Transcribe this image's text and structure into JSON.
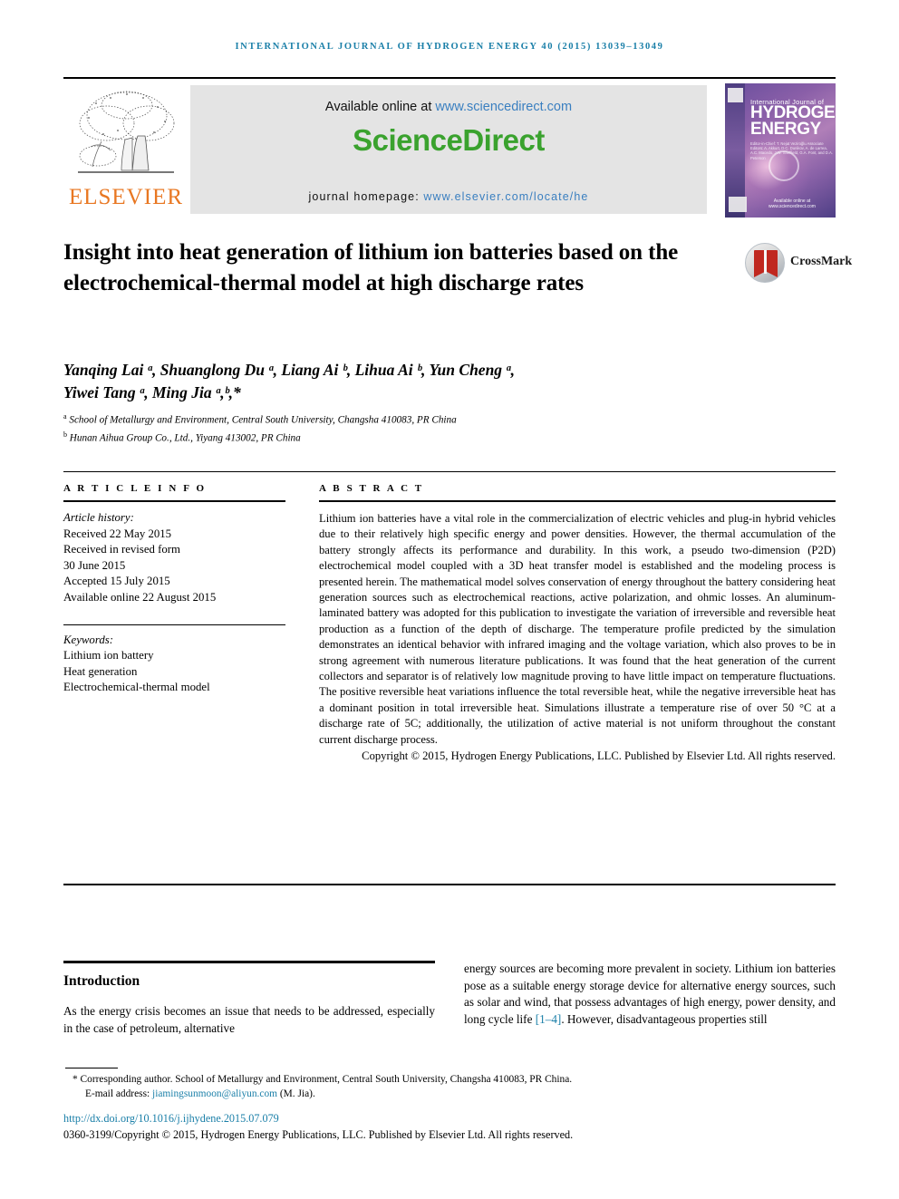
{
  "running_head": "INTERNATIONAL JOURNAL OF HYDROGEN ENERGY 40 (2015) 13039–13049",
  "masthead": {
    "publisher_name": "ELSEVIER",
    "publisher_logo_icon": "elsevier-tree-icon",
    "available_online_label": "Available online at ",
    "available_online_url": "www.sciencedirect.com",
    "sciencedirect_wordmark": "ScienceDirect",
    "journal_homepage_label": "journal homepage: ",
    "journal_homepage_url": "www.elsevier.com/locate/he",
    "cover": {
      "small_title": "International Journal of",
      "big_title_line1": "HYDROGEN",
      "big_title_line2": "ENERGY",
      "editors": "Editor-in-Chief: T. Nejat Veziroğlu   Associate Editors: A. Akkurt, D.C. Dunikov, A. de Larrea, A.C. Macedo, J.W. Sheffield, G.A. Font, and D.A. Peterson",
      "sciencedirect_note": "Available online at www.sciencedirect.com",
      "ihe_logo_icon": "ihe-logo-icon",
      "elsevier_mark_icon": "elsevier-mark-icon"
    }
  },
  "article": {
    "title": "Insight into heat generation of lithium ion batteries based on the electrochemical-thermal model at high discharge rates",
    "crossmark_label": "CrossMark",
    "crossmark_icon": "crossmark-icon",
    "authors_line1": "Yanqing Lai ᵃ, Shuanglong Du ᵃ, Liang Ai ᵇ, Lihua Ai ᵇ, Yun Cheng ᵃ,",
    "authors_line2": "Yiwei Tang ᵃ, Ming Jia ᵃ,ᵇ,*",
    "affiliation_a": "School of Metallurgy and Environment, Central South University, Changsha 410083, PR China",
    "affiliation_b": "Hunan Aihua Group Co., Ltd., Yiyang 413002, PR China"
  },
  "article_info": {
    "heading": "A R T I C L E   I N F O",
    "history_label": "Article history:",
    "history": [
      "Received 22 May 2015",
      "Received in revised form",
      "30 June 2015",
      "Accepted 15 July 2015",
      "Available online 22 August 2015"
    ],
    "keywords_label": "Keywords:",
    "keywords": [
      "Lithium ion battery",
      "Heat generation",
      "Electrochemical-thermal model"
    ]
  },
  "abstract": {
    "heading": "A B S T R A C T",
    "text": "Lithium ion batteries have a vital role in the commercialization of electric vehicles and plug-in hybrid vehicles due to their relatively high specific energy and power densities. However, the thermal accumulation of the battery strongly affects its performance and durability. In this work, a pseudo two-dimension (P2D) electrochemical model coupled with a 3D heat transfer model is established and the modeling process is presented herein. The mathematical model solves conservation of energy throughout the battery considering heat generation sources such as electrochemical reactions, active polarization, and ohmic losses. An aluminum-laminated battery was adopted for this publication to investigate the variation of irreversible and reversible heat production as a function of the depth of discharge. The temperature profile predicted by the simulation demonstrates an identical behavior with infrared imaging and the voltage variation, which also proves to be in strong agreement with numerous literature publications. It was found that the heat generation of the current collectors and separator is of relatively low magnitude proving to have little impact on temperature fluctuations. The positive reversible heat variations influence the total reversible heat, while the negative irreversible heat has a dominant position in total irreversible heat. Simulations illustrate a temperature rise of over 50 °C at a discharge rate of 5C; additionally, the utilization of active material is not uniform throughout the constant current discharge process.",
    "copyright": "Copyright © 2015, Hydrogen Energy Publications, LLC. Published by Elsevier Ltd. All rights reserved."
  },
  "body": {
    "intro_heading": "Introduction",
    "left_paragraph": "As the energy crisis becomes an issue that needs to be addressed, especially in the case of petroleum, alternative",
    "right_paragraph_before_ref": "energy sources are becoming more prevalent in society. Lithium ion batteries pose as a suitable energy storage device for alternative energy sources, such as solar and wind, that possess advantages of high energy, power density, and long cycle life ",
    "right_paragraph_ref": "[1–4]",
    "right_paragraph_after_ref": ". However, disadvantageous properties still"
  },
  "footer": {
    "corresponding_author": "* Corresponding author. School of Metallurgy and Environment, Central South University, Changsha 410083, PR China.",
    "email_label": "E-mail address: ",
    "email": "jiamingsunmoon@aliyun.com",
    "email_suffix": " (M. Jia).",
    "doi": "http://dx.doi.org/10.1016/j.ijhydene.2015.07.079",
    "issn_copyright": "0360-3199/Copyright © 2015, Hydrogen Energy Publications, LLC. Published by Elsevier Ltd. All rights reserved."
  },
  "colors": {
    "link_blue": "#1a7fa8",
    "sciencedirect_green": "#3aa22e",
    "elsevier_orange": "#e87722",
    "sd_box_gray": "#e4e4e4"
  }
}
